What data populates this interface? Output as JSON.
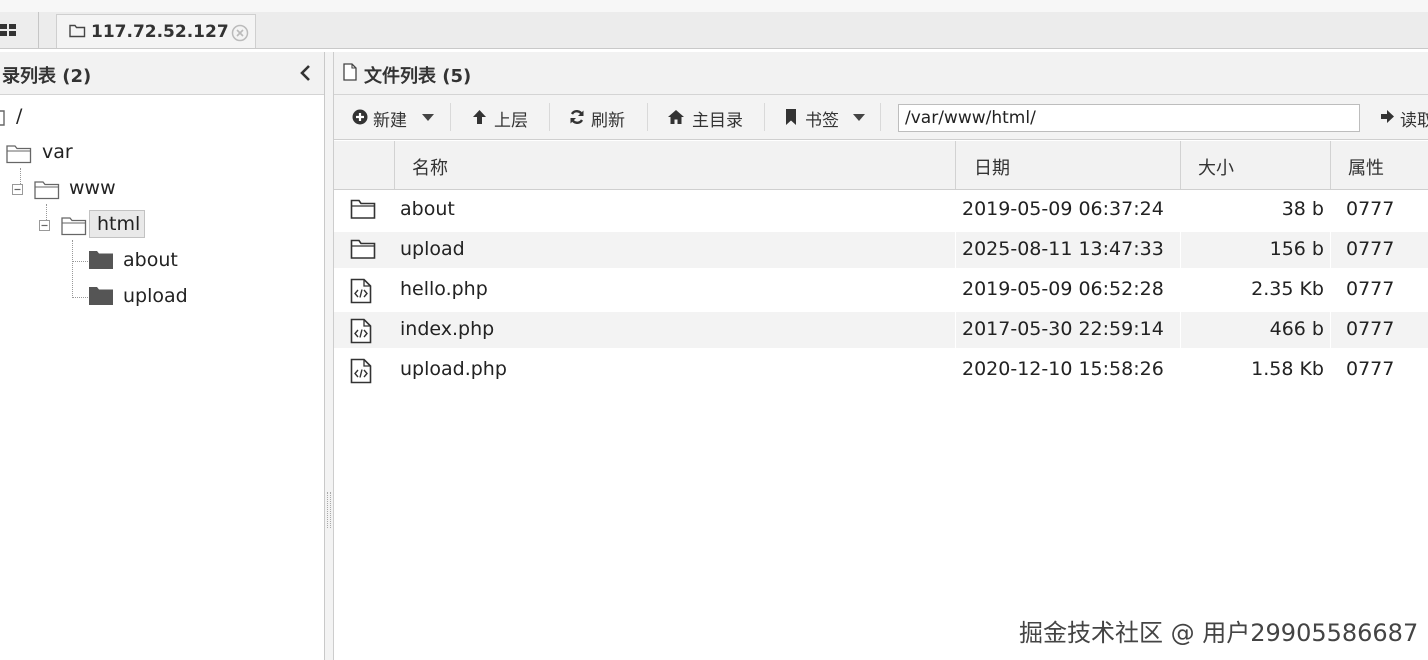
{
  "tabs": [
    {
      "label": "117.72.52.127",
      "icon": "folder-icon"
    }
  ],
  "left_panel": {
    "title": "录列表 (2)",
    "tree": [
      {
        "label": "/",
        "level": 0
      },
      {
        "label": "var",
        "level": 1
      },
      {
        "label": "www",
        "level": 2
      },
      {
        "label": "html",
        "level": 3,
        "selected": true
      },
      {
        "label": "about",
        "level": 4
      },
      {
        "label": "upload",
        "level": 4
      }
    ]
  },
  "right_panel": {
    "title": "文件列表 (5)",
    "toolbar": {
      "new_label": "新建",
      "up_label": "上层",
      "refresh_label": "刷新",
      "home_label": "主目录",
      "bookmark_label": "书签",
      "path_value": "/var/www/html/",
      "read_label": "读取"
    },
    "columns": {
      "name": "名称",
      "date": "日期",
      "size": "大小",
      "attr": "属性"
    },
    "files": [
      {
        "name": "about",
        "type": "folder",
        "date": "2019-05-09 06:37:24",
        "size": "38 b",
        "attr": "0777"
      },
      {
        "name": "upload",
        "type": "folder",
        "date": "2025-08-11 13:47:33",
        "size": "156 b",
        "attr": "0777"
      },
      {
        "name": "hello.php",
        "type": "code",
        "date": "2019-05-09 06:52:28",
        "size": "2.35 Kb",
        "attr": "0777"
      },
      {
        "name": "index.php",
        "type": "code",
        "date": "2017-05-30 22:59:14",
        "size": "466 b",
        "attr": "0777"
      },
      {
        "name": "upload.php",
        "type": "code",
        "date": "2020-12-10 15:58:26",
        "size": "1.58 Kb",
        "attr": "0777"
      }
    ]
  },
  "watermark": "掘金技术社区 @ 用户29905586687"
}
